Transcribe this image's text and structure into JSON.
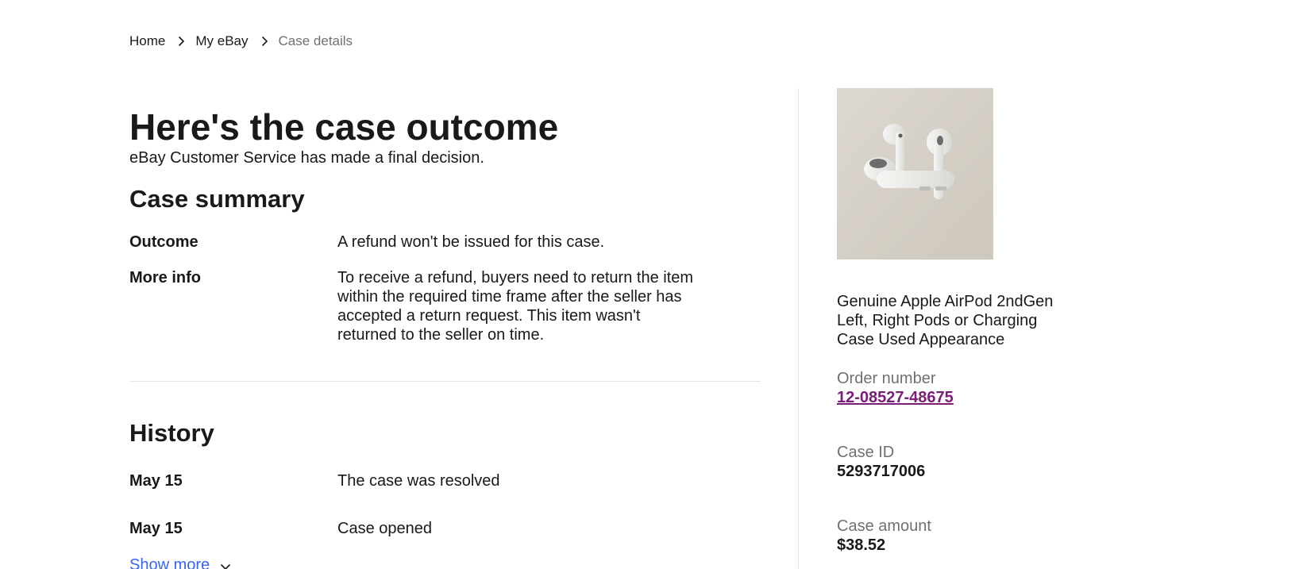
{
  "breadcrumb": {
    "items": [
      {
        "label": "Home"
      },
      {
        "label": "My eBay"
      },
      {
        "label": "Case details"
      }
    ]
  },
  "header": {
    "title": "Here's the case outcome",
    "subtitle": "eBay Customer Service has made a final decision."
  },
  "summary": {
    "heading": "Case summary",
    "outcome_label": "Outcome",
    "outcome_value": "A refund won't be issued for this case.",
    "more_info_label": "More info",
    "more_info_value": "To receive a refund, buyers need to return the item within the required time frame after the seller has accepted a return request. This item wasn't returned to the seller on time."
  },
  "history": {
    "heading": "History",
    "events": [
      {
        "date": "May 15",
        "description": "The case was resolved"
      },
      {
        "date": "May 15",
        "description": "Case opened"
      }
    ],
    "show_more_label": "Show more"
  },
  "sidebar": {
    "item_title": "Genuine Apple AirPod 2ndGen Left, Right Pods or Charging Case Used Appearance",
    "order_number_label": "Order number",
    "order_number": "12-08527-48675",
    "case_id_label": "Case ID",
    "case_id": "5293717006",
    "case_amount_label": "Case amount",
    "case_amount": "$38.52"
  },
  "colors": {
    "link_blue": "#3665f3",
    "visited_link_purple": "#7a1e78",
    "muted_text": "#707070",
    "divider": "#e5e5e5"
  },
  "icons": {
    "breadcrumb_separator": "chevron-right-icon",
    "show_more": "chevron-down-icon"
  }
}
